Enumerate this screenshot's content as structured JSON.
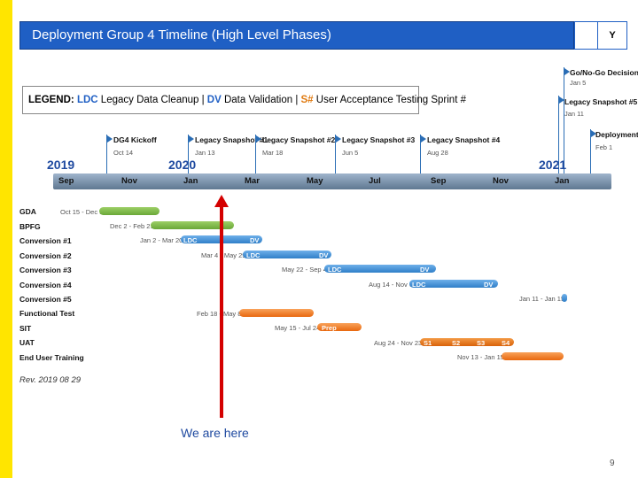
{
  "header": {
    "title": "Deployment Group 4 Timeline (High Level Phases)",
    "flag": "Y"
  },
  "legend": {
    "prefix": "LEGEND:",
    "ldc_code": "LDC",
    "ldc_text": "Legacy Data Cleanup |",
    "dv_code": "DV",
    "dv_text": "Data Validation |",
    "s_code": "S#",
    "s_text": "User Acceptance Testing Sprint #"
  },
  "milestones": [
    {
      "name": "DG4 Kickoff",
      "date": "Oct 14"
    },
    {
      "name": "Legacy Snapshot #1",
      "date": "Jan 13"
    },
    {
      "name": "Legacy Snapshot #2",
      "date": "Mar 18"
    },
    {
      "name": "Legacy Snapshot #3",
      "date": "Jun 5"
    },
    {
      "name": "Legacy Snapshot #4",
      "date": "Aug 28"
    },
    {
      "name": "Go/No-Go Decision",
      "date": "Jan 5"
    },
    {
      "name": "Legacy Snapshot #5",
      "date": "Jan 11"
    },
    {
      "name": "Deployment",
      "date": "Feb 1"
    }
  ],
  "years": [
    "2019",
    "2020",
    "2021"
  ],
  "months": [
    "Sep",
    "Nov",
    "Jan",
    "Mar",
    "May",
    "Jul",
    "Sep",
    "Nov",
    "Jan"
  ],
  "rows": [
    {
      "label": "GDA",
      "range": "Oct 15 - Dec 9"
    },
    {
      "label": "BPFG",
      "range": "Dec 2 - Feb 21"
    },
    {
      "label": "Conversion #1",
      "range": "Jan 2 - Mar 20",
      "tags": [
        "LDC",
        "DV"
      ]
    },
    {
      "label": "Conversion #2",
      "range": "Mar 4 - May 29",
      "tags": [
        "LDC",
        "DV"
      ]
    },
    {
      "label": "Conversion #3",
      "range": "May 22 - Sep 4",
      "tags": [
        "LDC",
        "DV"
      ]
    },
    {
      "label": "Conversion #4",
      "range": "Aug 14 - Nov 6",
      "tags": [
        "LDC",
        "DV"
      ]
    },
    {
      "label": "Conversion #5",
      "range": "Jan 11 - Jan 15"
    },
    {
      "label": "Functional Test",
      "range": "Feb 18 - May 8"
    },
    {
      "label": "SIT",
      "range": "May 15 - Jul 24",
      "tags": [
        "Prep"
      ]
    },
    {
      "label": "UAT",
      "range": "Aug 24 - Nov 23",
      "tags": [
        "S1",
        "S2",
        "S3",
        "S4"
      ]
    },
    {
      "label": "End User Training",
      "range": "Nov 13 - Jan 15"
    }
  ],
  "revision": "Rev. 2019 08 29",
  "marker_text": "We are here",
  "page_number": "9",
  "colors": {
    "title_bg": "#1f5fc4",
    "stripe": "#ffe500",
    "green": "#7ab648",
    "blue": "#3f8fd6",
    "orange": "#f07a1e",
    "marker": "#d40000"
  }
}
